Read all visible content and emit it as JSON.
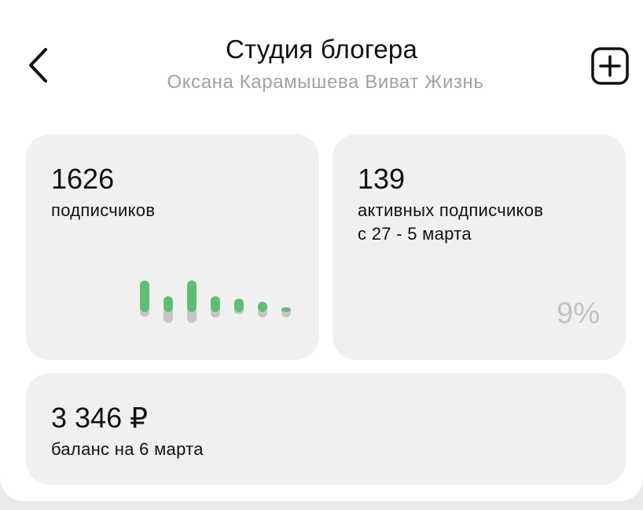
{
  "header": {
    "title": "Студия блогера",
    "subtitle": "Оксана Карамышева Виват Жизнь",
    "back_icon": "chevron-left-icon",
    "add_icon": "plus-square-icon"
  },
  "subscribers_card": {
    "count": "1626",
    "label": "подписчиков",
    "chart_data": {
      "type": "bar",
      "series": [
        {
          "values": [
            40,
            20,
            40,
            20,
            17,
            13,
            6
          ]
        },
        {
          "values": [
            -6,
            -14,
            -14,
            -7,
            -3,
            -7,
            -7
          ]
        }
      ],
      "colors": [
        "#5cbf72",
        "#c5c5c7"
      ]
    }
  },
  "active_card": {
    "count": "139",
    "label_line1": "активных подписчиков",
    "label_line2": "с 27 - 5 марта",
    "percent": "9%"
  },
  "balance_card": {
    "amount": "3 346 ₽",
    "label": "баланс на 6 марта"
  }
}
